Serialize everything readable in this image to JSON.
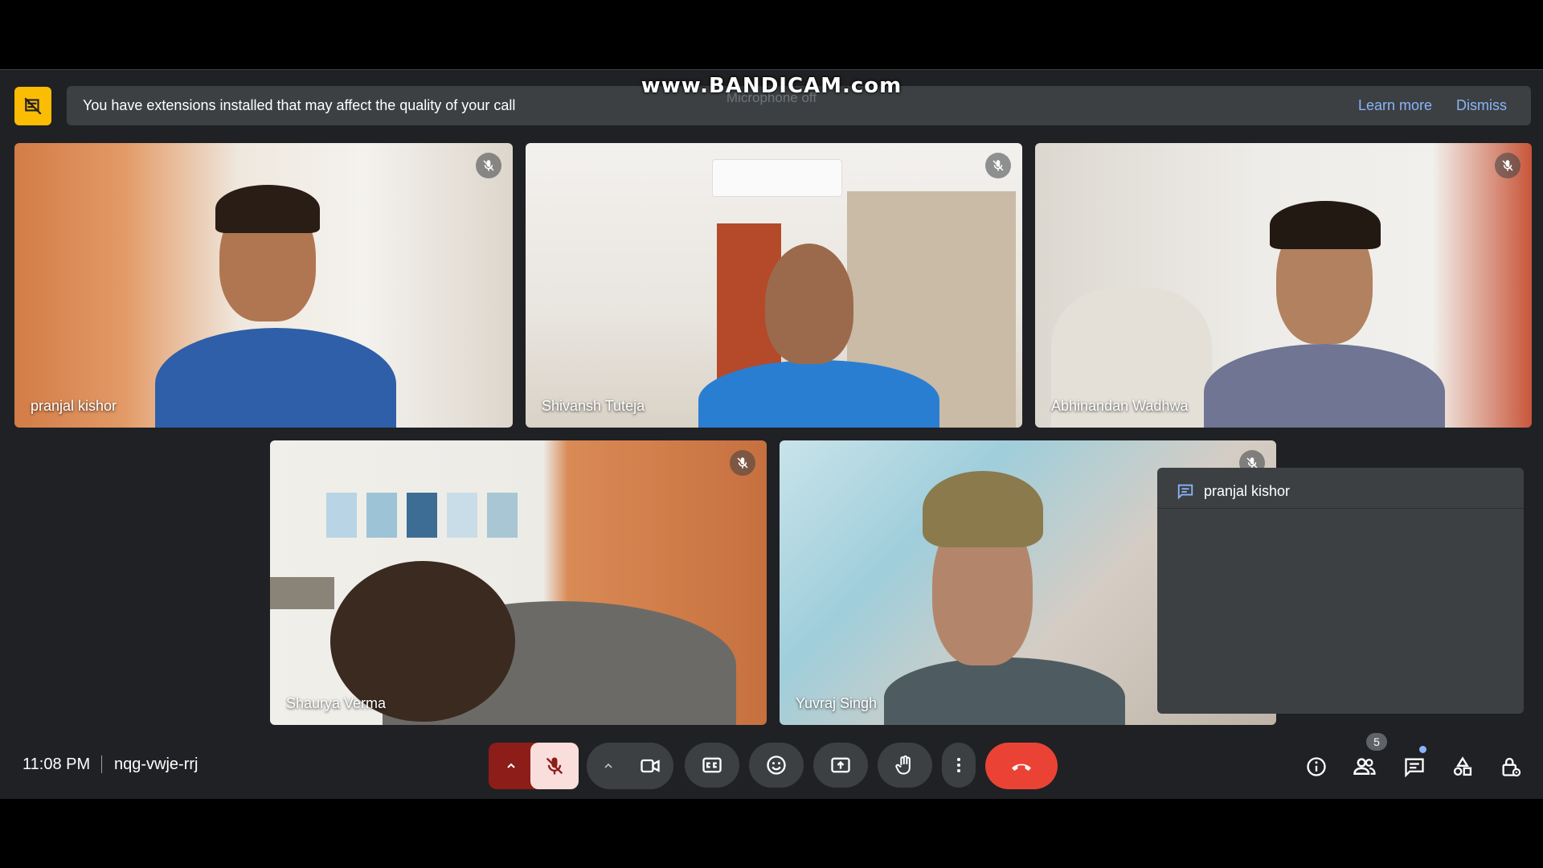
{
  "watermark": "www.BANDICAM.com",
  "ghost_toast": "Microphone off",
  "banner": {
    "message": "You have extensions installed that may affect the quality of your call",
    "learn_more": "Learn more",
    "dismiss": "Dismiss"
  },
  "participants": [
    {
      "name": "pranjal kishor",
      "muted": true
    },
    {
      "name": "Shivansh Tuteja",
      "muted": true
    },
    {
      "name": "Abhinandan Wadhwa",
      "muted": true
    },
    {
      "name": "Shaurya Verma",
      "muted": true
    },
    {
      "name": "Yuvraj Singh",
      "muted": true
    }
  ],
  "chat_panel": {
    "title": "pranjal kishor",
    "icon": "chat-icon"
  },
  "meeting": {
    "time": "11:08 PM",
    "code": "nqg-vwje-rrj"
  },
  "toolbar": {
    "icons": [
      "caret-up-icon",
      "mic-off-icon",
      "caret-up-icon",
      "camera-icon",
      "captions-icon",
      "emoji-icon",
      "present-icon",
      "raise-hand-icon",
      "more-vert-icon",
      "end-call-icon"
    ],
    "mic_state": "off"
  },
  "right_controls": {
    "icons": [
      "info-icon",
      "people-icon",
      "chat-icon",
      "activities-icon",
      "host-controls-icon"
    ],
    "people_count": "5"
  },
  "colors": {
    "background": "#202124",
    "banner": "#3c4043",
    "accent_link": "#8ab4f8",
    "end_call": "#ea4335",
    "mic_off_bg": "#f9dedc",
    "mic_group": "#8c1d18",
    "extension_warning": "#fbbc04"
  }
}
